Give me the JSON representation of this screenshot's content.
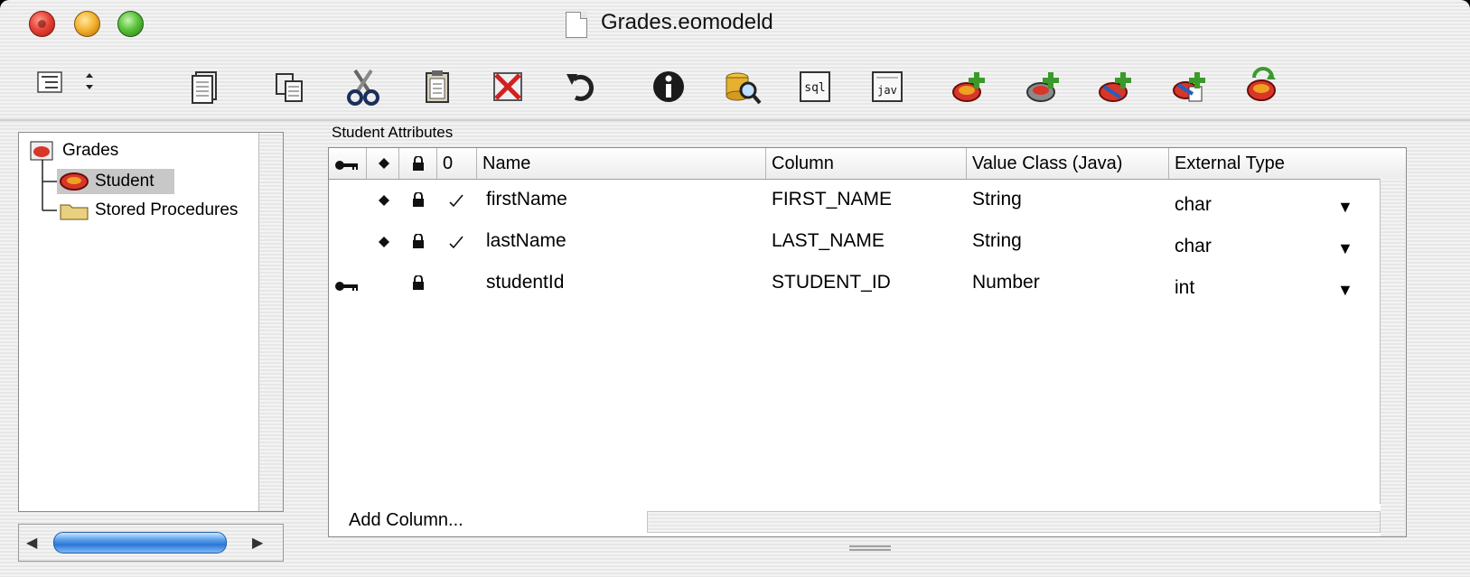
{
  "window": {
    "title": "Grades.eomodeld"
  },
  "toolbar": {
    "buttons": [
      {
        "name": "new-document-icon"
      },
      {
        "name": "copy-icon"
      },
      {
        "name": "cut-icon"
      },
      {
        "name": "paste-icon"
      },
      {
        "name": "delete-icon"
      },
      {
        "name": "undo-icon"
      },
      {
        "name": "info-icon"
      },
      {
        "name": "browse-data-icon"
      },
      {
        "name": "sql-icon"
      },
      {
        "name": "java-icon"
      },
      {
        "name": "add-entity-icon"
      },
      {
        "name": "add-attribute-icon"
      },
      {
        "name": "add-relationship-icon"
      },
      {
        "name": "add-fetch-spec-icon"
      },
      {
        "name": "flatten-icon"
      }
    ]
  },
  "tree": {
    "items": [
      {
        "label": "Grades"
      },
      {
        "label": "Student"
      },
      {
        "label": "Stored Procedures"
      }
    ]
  },
  "table": {
    "title": "Student Attributes",
    "headers": {
      "key": "",
      "lock_a": "",
      "lock_b": "",
      "null": "0",
      "name": "Name",
      "column": "Column",
      "value_class": "Value Class (Java)",
      "external_type": "External Type"
    },
    "rows": [
      {
        "name": "firstName",
        "column": "FIRST_NAME",
        "value_class": "String",
        "external_type": "char",
        "primary_key": false,
        "class_property": true,
        "locking": true,
        "allows_null": true
      },
      {
        "name": "lastName",
        "column": "LAST_NAME",
        "value_class": "String",
        "external_type": "char",
        "primary_key": false,
        "class_property": true,
        "locking": true,
        "allows_null": true
      },
      {
        "name": "studentId",
        "column": "STUDENT_ID",
        "value_class": "Number",
        "external_type": "int",
        "primary_key": true,
        "class_property": false,
        "locking": true,
        "allows_null": false
      }
    ],
    "add_column_label": "Add Column..."
  }
}
